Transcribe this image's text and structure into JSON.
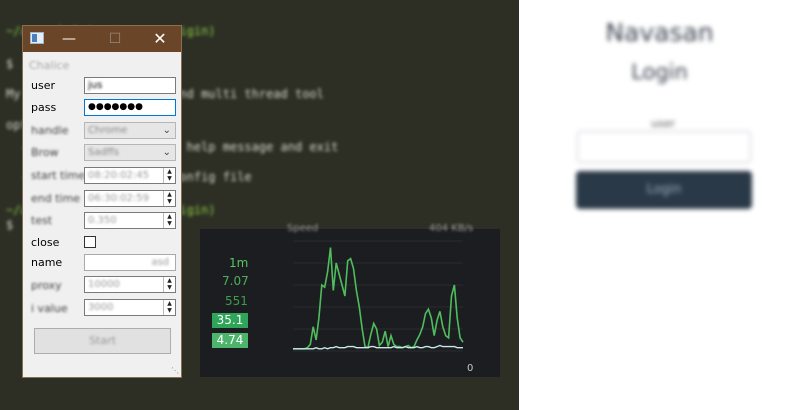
{
  "terminal": {
    "lines": [
      {
        "text": "~/app  1.0 (master -> origin)",
        "color": "green"
      },
      {
        "text": "$ ./run [-h] [-c CONFIG]",
        "color": "white"
      },
      {
        "text": "My utility, automation and multi thread tool",
        "color": "white"
      },
      {
        "text": "optional arguments:",
        "color": "white"
      },
      {
        "text": "  -h, --help   show this help message and exit",
        "color": "white"
      },
      {
        "text": "  -c CONFIG    path of config file",
        "color": "white"
      },
      {
        "text": "~/app  1.0 (master -> origin)",
        "color": "green"
      },
      {
        "text": "$ ",
        "color": "white"
      }
    ]
  },
  "web": {
    "title": "Navasan",
    "subtitle": "Login",
    "user_label": "user",
    "button_label": "Login"
  },
  "dialog": {
    "title_icon": "app-window-icon",
    "status": "Chalice",
    "user_label": "user",
    "user_value": "jus",
    "pass_label": "pass",
    "pass_value": "●●●●●●●",
    "handle_label": "handle",
    "handle_value": "Chrome",
    "browser_label": "Brow",
    "browser_value": "Sadffs",
    "start_time_label": "start time",
    "start_time_value": "08:20:02:45",
    "end_time_label": "end time",
    "end_time_value": "06:30:02:59",
    "test_label": "test",
    "test_value": "0.350",
    "close_label": "close",
    "close_checked": false,
    "name_label": "name",
    "name_value": "asd",
    "proxy_label": "proxy",
    "proxy_value": "10000",
    "value_label": "i value",
    "value_value": "3000",
    "start_button": "Start"
  },
  "monitor": {
    "header_left": "Speed",
    "header_right": "404 KB/s",
    "stat_labels": [
      "1m",
      "7.07",
      "551"
    ],
    "boxes": [
      "35.1",
      "4.74"
    ],
    "axis_zero": "0",
    "colors": {
      "primary": "#4fbd5e",
      "secondary": "#c9e7e9"
    }
  },
  "chart_data": {
    "type": "line",
    "title": "Speed",
    "ylim": [
      0,
      100
    ],
    "x": [
      0,
      1,
      2,
      3,
      4,
      5,
      6,
      7,
      8,
      9,
      10,
      11,
      12,
      13,
      14,
      15,
      16,
      17,
      18,
      19,
      20,
      21,
      22,
      23,
      24,
      25,
      26,
      27,
      28,
      29,
      30,
      31,
      32,
      33,
      34,
      35,
      36,
      37,
      38,
      39,
      40,
      41,
      42,
      43,
      44,
      45,
      46,
      47,
      48,
      49,
      50,
      51,
      52,
      53,
      54,
      55,
      56,
      57,
      58,
      59
    ],
    "series": [
      {
        "values": [
          2,
          2,
          2,
          2,
          2,
          3,
          6,
          22,
          10,
          30,
          60,
          58,
          72,
          94,
          55,
          80,
          70,
          60,
          50,
          82,
          84,
          75,
          55,
          40,
          20,
          4,
          3,
          15,
          25,
          20,
          5,
          8,
          18,
          4,
          14,
          6,
          4,
          4,
          3,
          4,
          5,
          3,
          4,
          10,
          15,
          22,
          34,
          38,
          30,
          14,
          28,
          36,
          22,
          14,
          12,
          50,
          60,
          30,
          12,
          8
        ]
      },
      {
        "values": [
          2,
          2,
          2,
          2,
          2,
          2,
          2,
          2,
          3,
          2,
          2,
          3,
          2,
          3,
          3,
          4,
          3,
          3,
          3,
          4,
          4,
          4,
          3,
          3,
          3,
          3,
          3,
          4,
          4,
          3,
          3,
          3,
          3,
          3,
          3,
          4,
          3,
          3,
          3,
          4,
          3,
          3,
          3,
          4,
          3,
          3,
          4,
          4,
          3,
          3,
          4,
          5,
          4,
          4,
          4,
          4,
          4,
          3,
          3,
          3
        ]
      }
    ]
  }
}
